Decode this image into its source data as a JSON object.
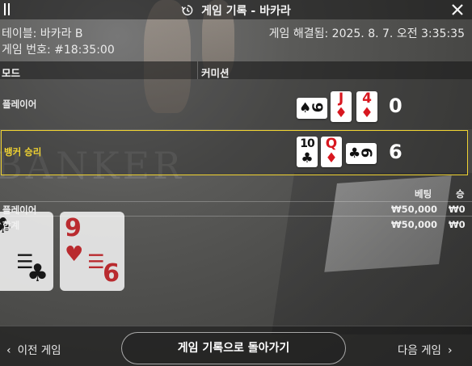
{
  "header": {
    "title": "게임 기록 - 바카라"
  },
  "info": {
    "table_label": "테이블: 바카라 B",
    "resolved_label": "게임 해결됨: 2025. 8. 7. 오전 3:35:35",
    "game_number": "게임 번호: #18:35:00"
  },
  "columns": {
    "mode": "모드",
    "commission": "커미션"
  },
  "hands": {
    "player": {
      "label": "플레이어",
      "score": "0",
      "cards": [
        {
          "rank": "9",
          "suit": "♠",
          "color": "#111111",
          "orientation": "sideways"
        },
        {
          "rank": "J",
          "suit": "♦",
          "color": "#d8171f",
          "orientation": "upright"
        },
        {
          "rank": "4",
          "suit": "♦",
          "color": "#d8171f",
          "orientation": "upright"
        }
      ]
    },
    "banker": {
      "label": "뱅커 승리",
      "label_color": "#f0d331",
      "score": "6",
      "cards": [
        {
          "rank": "10",
          "suit": "♣",
          "color": "#111111",
          "orientation": "upright"
        },
        {
          "rank": "Q",
          "suit": "♦",
          "color": "#d8171f",
          "orientation": "upright"
        },
        {
          "rank": "6",
          "suit": "♣",
          "color": "#111111",
          "orientation": "sideways"
        }
      ]
    }
  },
  "bets": {
    "columns": {
      "bet": "베팅",
      "win": "승"
    },
    "rows": [
      {
        "label": "플레이어",
        "bet": "₩50,000",
        "win": "₩0"
      },
      {
        "label": "합계",
        "bet": "₩50,000",
        "win": "₩0"
      }
    ]
  },
  "footer": {
    "prev_label": "이전 게임",
    "back_label": "게임 기록으로 돌아가기",
    "next_label": "다음 게임"
  },
  "colors": {
    "winner_border": "#f0d331",
    "red_suit": "#d8171f",
    "black_suit": "#111111"
  }
}
